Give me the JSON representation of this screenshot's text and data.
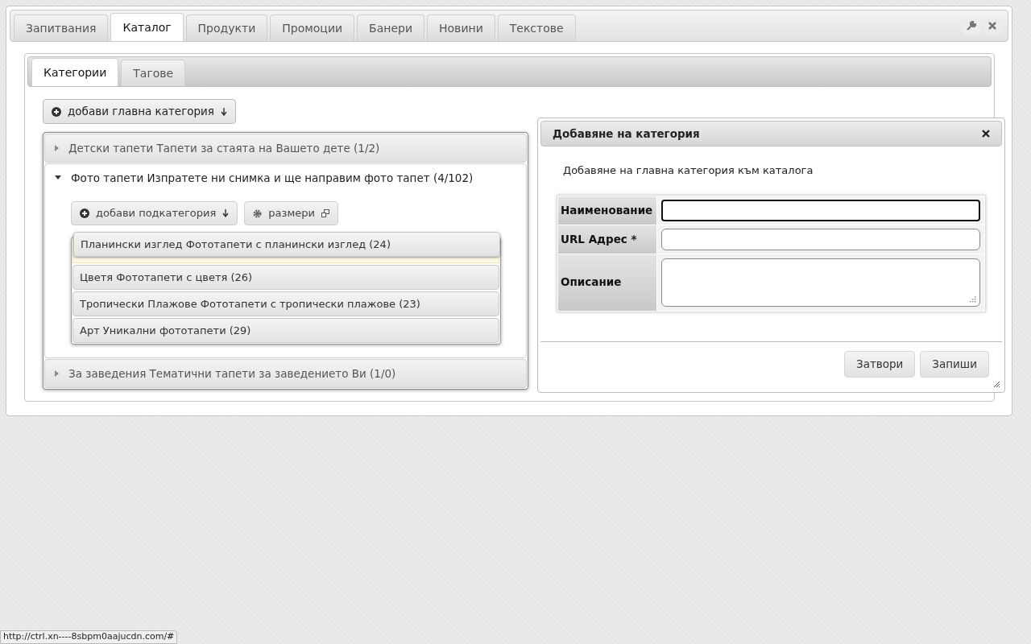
{
  "tabs": [
    {
      "label": "Запитвания",
      "selected": false
    },
    {
      "label": "Каталог",
      "selected": true
    },
    {
      "label": "Продукти",
      "selected": false
    },
    {
      "label": "Промоции",
      "selected": false
    },
    {
      "label": "Банери",
      "selected": false
    },
    {
      "label": "Новини",
      "selected": false
    },
    {
      "label": "Текстове",
      "selected": false
    }
  ],
  "subtabs": [
    {
      "label": "Категории",
      "selected": true
    },
    {
      "label": "Тагове",
      "selected": false
    }
  ],
  "add_main_button": "добави главна категория",
  "categories": [
    {
      "label": "Детски тапети Тапети за стаята на Вашето дете (1/2)",
      "expanded": false
    },
    {
      "label": "Фото тапети Изпратете ни снимка и ще направим фото тапет (4/102)",
      "expanded": true,
      "actions": [
        {
          "label": "добави подкатегория",
          "kind": "add"
        },
        {
          "label": "размери",
          "kind": "sizes"
        }
      ],
      "children": [
        {
          "label": "Планински изглед Фототапети с планински изглед (24)",
          "dragging": true
        },
        {
          "label": "Цветя Фототапети с цветя (26)",
          "dragging": false
        },
        {
          "label": "Тропически Плажове Фототапети с тропически плажове (23)",
          "dragging": false
        },
        {
          "label": "Арт Уникални фототапети (29)",
          "dragging": false
        }
      ]
    },
    {
      "label": "За заведения Тематични тапети за заведението Ви (1/0)",
      "expanded": false
    }
  ],
  "dialog": {
    "title": "Добавяне на категория",
    "description": "Добавяне на главна категория към каталога",
    "fields": [
      {
        "label": "Наименование",
        "kind": "text",
        "focused": true
      },
      {
        "label": "URL Адрес *",
        "kind": "text",
        "focused": false
      },
      {
        "label": "Описание",
        "kind": "textarea",
        "focused": false
      }
    ],
    "buttons": [
      "Затвори",
      "Запиши"
    ]
  },
  "status_bar": {
    "url": "http://ctrl.xn----8sbpm0aajucdn.com/#"
  }
}
